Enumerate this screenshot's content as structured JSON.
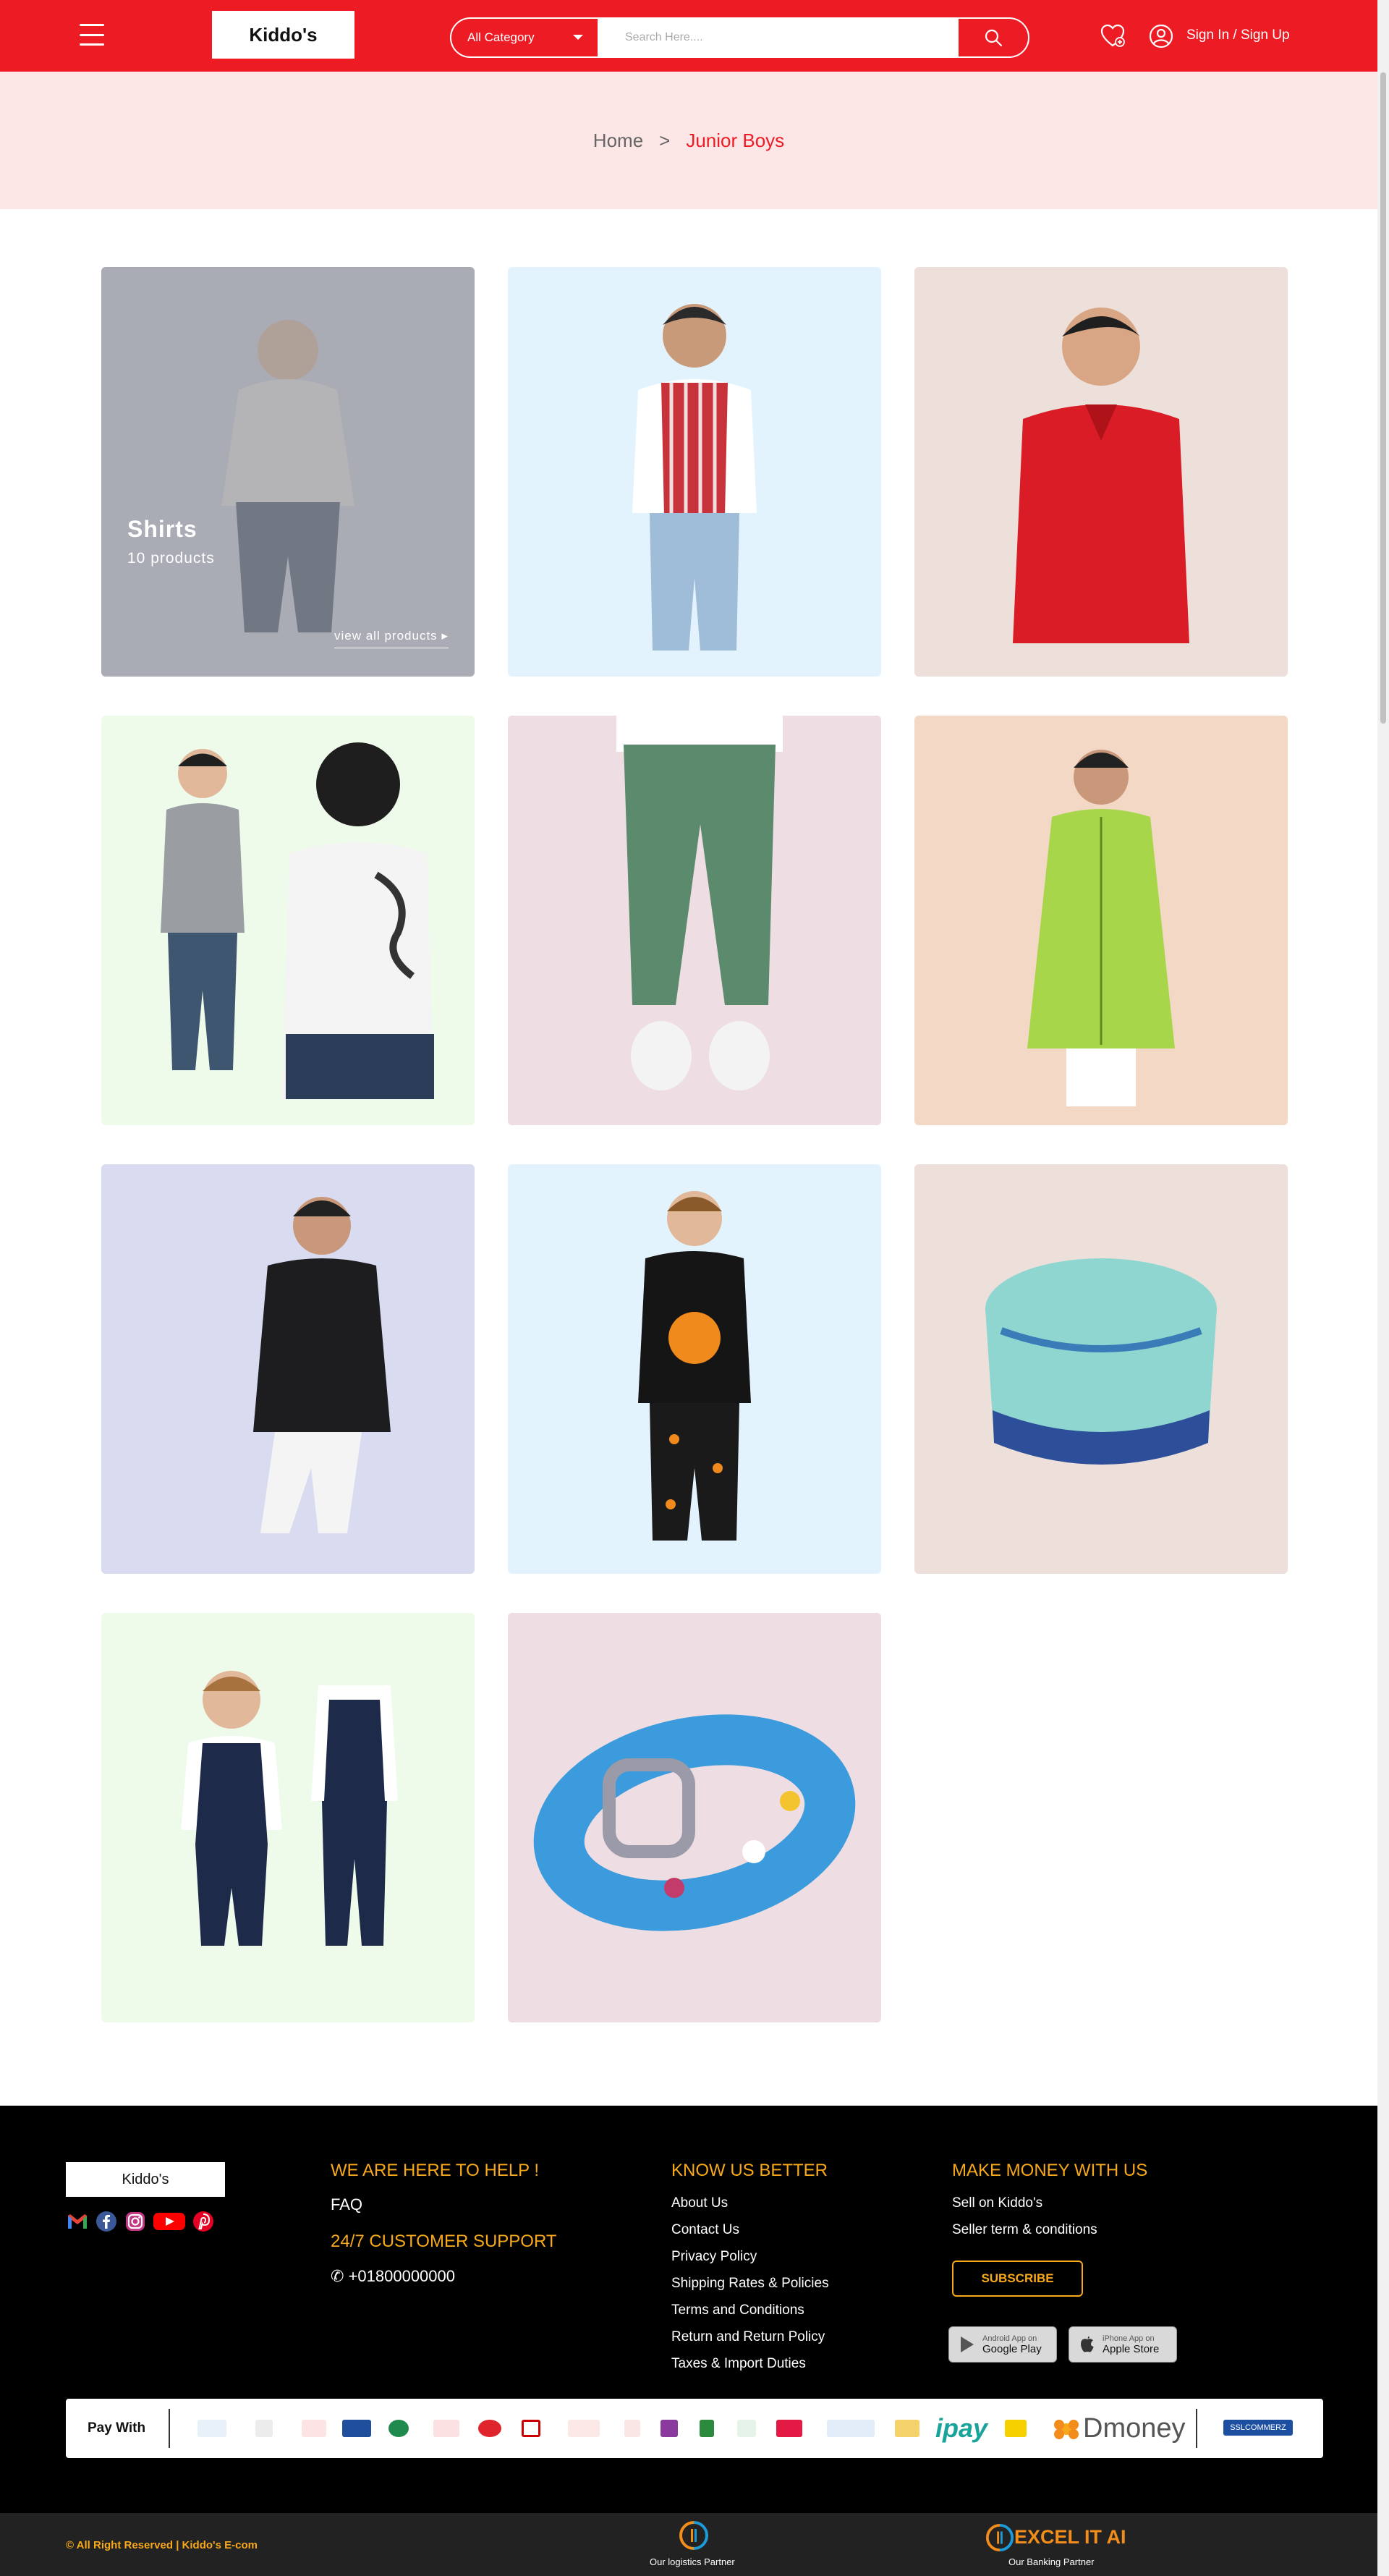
{
  "header": {
    "logo": "Kiddo's",
    "category_label": "All Category",
    "search_placeholder": "Search Here....",
    "signin": "Sign In / Sign Up",
    "bg_color": "#ed1c24"
  },
  "breadcrumb": {
    "home": "Home",
    "separator": ">",
    "current": "Junior Boys"
  },
  "categories": [
    {
      "title": "Shirts",
      "count": "10 products",
      "link": "view all products",
      "bg": "#d9dbe6"
    },
    {
      "bg": "#e2f3fd"
    },
    {
      "bg": "#ede0da"
    },
    {
      "bg": "#eefaea"
    },
    {
      "bg": "#eedee3"
    },
    {
      "bg": "#f4d8c6"
    },
    {
      "bg": "#d9dcf0"
    },
    {
      "bg": "#e2f3fd"
    },
    {
      "bg": "#ede0da"
    },
    {
      "bg": "#eefaea"
    },
    {
      "bg": "#eedee3"
    }
  ],
  "footer": {
    "logo": "Kiddo's",
    "help_heading": "WE ARE HERE TO HELP !",
    "faq": "FAQ",
    "support_heading": "24/7 CUSTOMER SUPPORT",
    "phone": "+01800000000",
    "know_heading": "KNOW US BETTER",
    "know_links": [
      "About Us",
      "Contact Us",
      "Privacy Policy",
      "Shipping Rates & Policies",
      "Terms and Conditions",
      "Return and Return Policy",
      "Taxes & Import Duties"
    ],
    "money_heading": "MAKE MONEY WITH US",
    "money_links": [
      "Sell on Kiddo's",
      "Seller term & conditions"
    ],
    "subscribe": "SUBSCRIBE",
    "google_small": "Android App on",
    "google_big": "Google Play",
    "apple_small": "iPhone App on",
    "apple_big": "Apple Store",
    "pay_with": "Pay With",
    "ipay": "ipay",
    "dmoney": "Dmoney",
    "ssl": "SSLCOMMERZ",
    "rights": "© All Right Reserved | Kiddo's E-com",
    "logistics": "Our logistics Partner",
    "banking": "Our Banking Partner",
    "excel": "EXCEL IT AI",
    "accent": "#f7a81b"
  },
  "icons": [
    "menu-icon",
    "search-icon",
    "wishlist-icon",
    "user-icon",
    "gmail-icon",
    "facebook-icon",
    "instagram-icon",
    "youtube-icon",
    "pinterest-icon",
    "google-play-icon",
    "apple-icon"
  ]
}
